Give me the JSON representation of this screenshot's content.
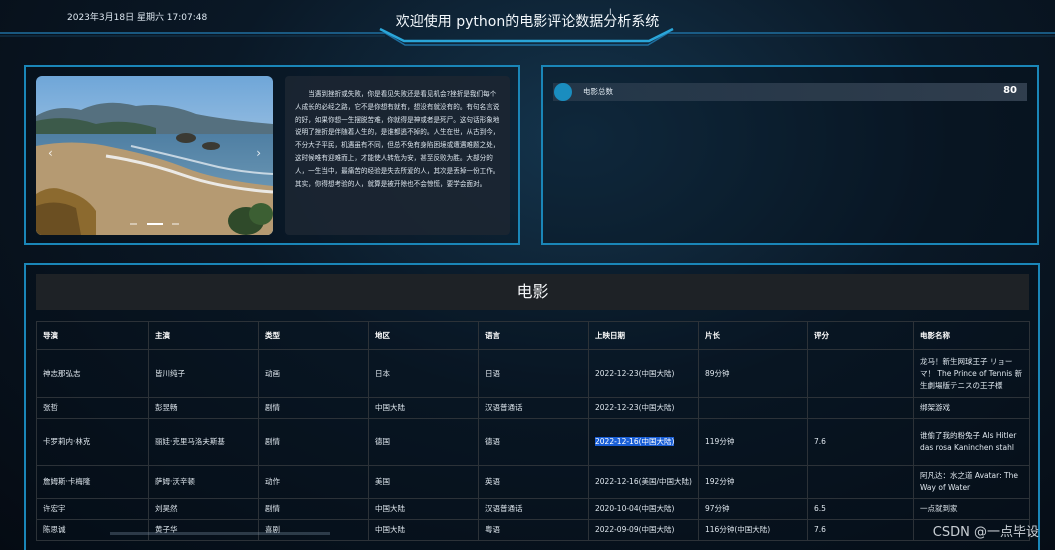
{
  "header": {
    "datetime": "2023年3月18日 星期六 17:07:48",
    "title": "欢迎使用 python的电影评论数据分析系统"
  },
  "intro": {
    "carousel": {
      "prev_label": "‹",
      "next_label": "›",
      "slide_count": 3,
      "active_slide": 2
    },
    "quote": "当遇到挫折或失败，你是看见失败还是看见机会?挫折是我们每个人成长的必经之路，它不是你想有就有，想没有就没有的。有句名言说的好，如果你想一生摆脱苦难，你就得是神或者是死尸。这句话形象地说明了挫折是伴随着人生的，是谁都逃不掉的。人生在世，从古到今，不分大子平民，机遇虽有不同，但总不免有身陷困境或遭遇难题之处，这时候唯有迎难而上，才能使人转危为安，甚至反败为胜。大部分的人，一生当中，最痛苦的经验是失去所爱的人，其次是丢掉一份工作。其实，你得想考验的人，就算是被开除也不会惊慌，要学会面对。"
  },
  "stats": {
    "label": "电影总数",
    "value": "80"
  },
  "movies": {
    "title": "电影",
    "columns": [
      "导演",
      "主演",
      "类型",
      "地区",
      "语言",
      "上映日期",
      "片长",
      "评分",
      "电影名称"
    ],
    "rows": [
      [
        "神志那弘志",
        "皆川纯子",
        "动画",
        "日本",
        "日语",
        "2022-12-23(中国大陆)",
        "89分钟",
        "",
        "龙马！新生网球王子 リョーマ！ The Prince of Tennis 新生劇場版テニスの王子様"
      ],
      [
        "张哲",
        "彭昱畅",
        "剧情",
        "中国大陆",
        "汉语普通话",
        "2022-12-23(中国大陆)",
        "",
        "",
        "绑架游戏"
      ],
      [
        "卡罗莉内·林克",
        "丽娃·克里马洛夫斯基",
        "剧情",
        "德国",
        "德语",
        "2022-12-16(中国大陆)",
        "119分钟",
        "7.6",
        "谁偷了我的粉兔子 Als Hitler das rosa Kaninchen stahl"
      ],
      [
        "詹姆斯·卡梅隆",
        "萨姆·沃辛顿",
        "动作",
        "美国",
        "英语",
        "2022-12-16(美国/中国大陆)",
        "192分钟",
        "",
        "阿凡达：水之道 Avatar: The Way of Water"
      ],
      [
        "许宏宇",
        "刘昊然",
        "剧情",
        "中国大陆",
        "汉语普通话",
        "2020-10-04(中国大陆)",
        "97分钟",
        "6.5",
        "一点就到家"
      ],
      [
        "陈思诚",
        "黄子华",
        "喜剧",
        "中国大陆",
        "粤语",
        "2022-09-09(中国大陆)",
        "116分钟(中国大陆)",
        "7.6",
        ""
      ]
    ]
  },
  "watermark": "CSDN @一点毕设",
  "colors": {
    "panel_border": "#1a86b8",
    "accent": "#1a8dbf",
    "background": "#0a1826",
    "selection": "#1a5fd6"
  }
}
